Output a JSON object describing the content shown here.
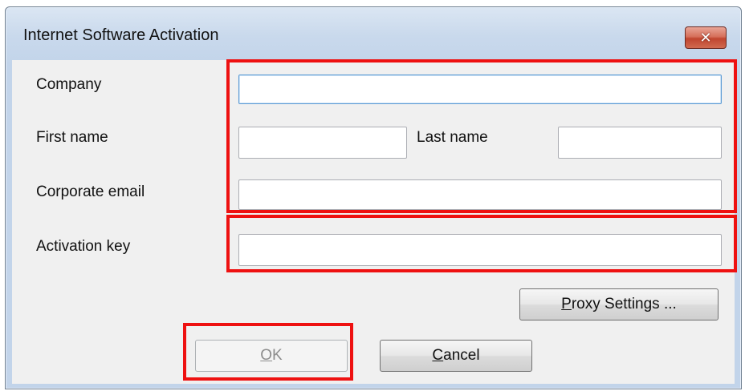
{
  "window": {
    "title": "Internet Software Activation",
    "close_glyph": "✕"
  },
  "form": {
    "company_label": "Company",
    "company_value": "",
    "first_name_label": "First name",
    "first_name_value": "",
    "last_name_label": "Last name",
    "last_name_value": "",
    "email_label": "Corporate email",
    "email_value": "",
    "activation_key_label": "Activation key",
    "activation_key_value": ""
  },
  "buttons": {
    "proxy_mnemonic": "P",
    "proxy_rest": "roxy Settings ...",
    "ok_mnemonic": "O",
    "ok_rest": "K",
    "ok_enabled": false,
    "cancel_mnemonic": "C",
    "cancel_rest": "ancel"
  },
  "annotation": {
    "highlight_color": "#ee1111"
  }
}
